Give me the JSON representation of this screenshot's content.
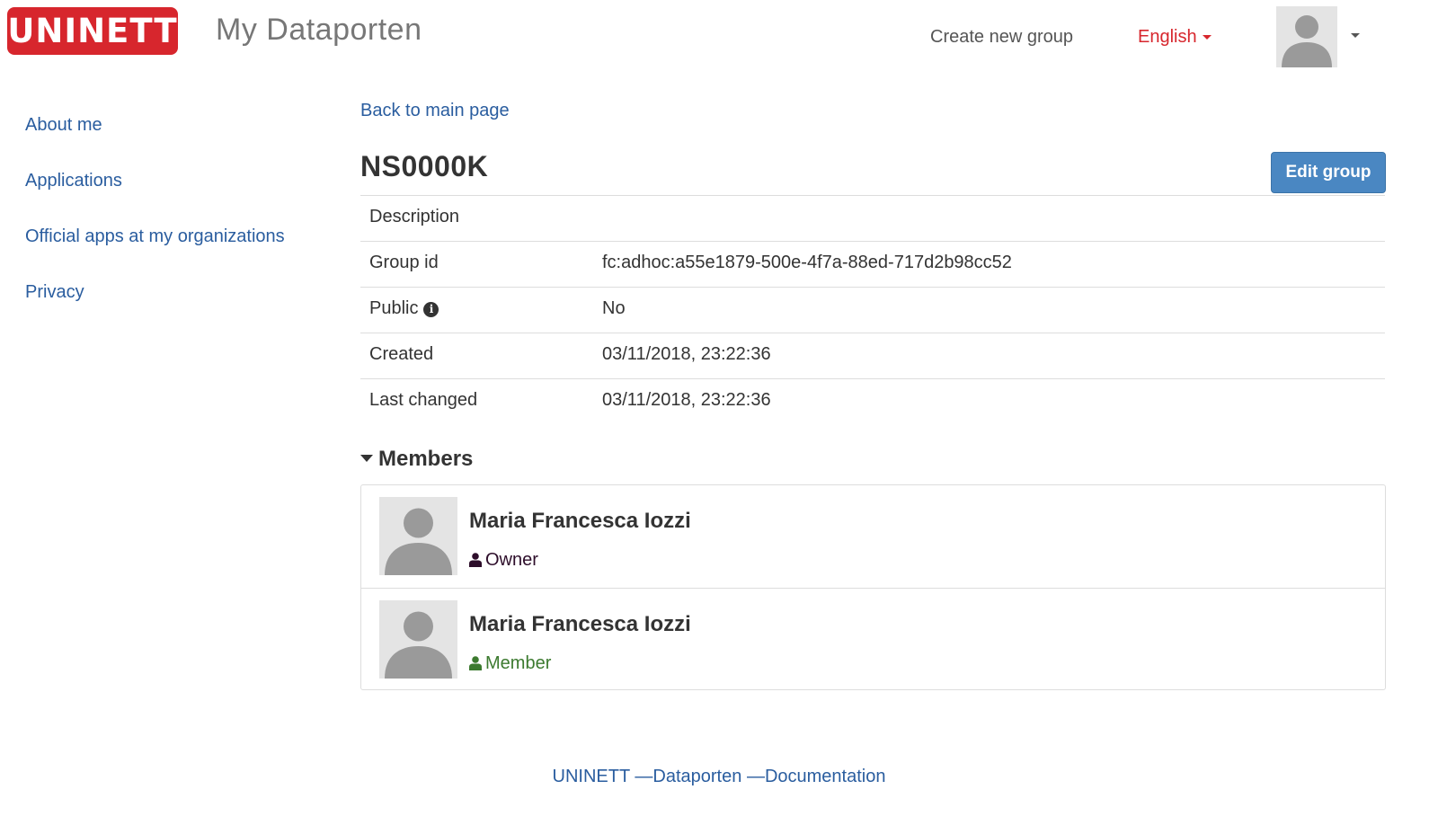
{
  "header": {
    "logo_text": "UNINETT",
    "app_title": "My Dataporten",
    "create_group": "Create new group",
    "language": "English"
  },
  "sidebar": {
    "items": [
      {
        "label": "About me"
      },
      {
        "label": "Applications"
      },
      {
        "label": "Official apps at my organizations"
      },
      {
        "label": "Privacy"
      }
    ]
  },
  "main": {
    "back_link": "Back to main page",
    "group_title": "NS0000K",
    "edit_button": "Edit group",
    "info": [
      {
        "label": "Description",
        "value": ""
      },
      {
        "label": "Group id",
        "value": "fc:adhoc:a55e1879-500e-4f7a-88ed-717d2b98cc52"
      },
      {
        "label": "Public",
        "value": "No",
        "icon": "info-icon"
      },
      {
        "label": "Created",
        "value": "03/11/2018, 23:22:36"
      },
      {
        "label": "Last changed",
        "value": "03/11/2018, 23:22:36"
      }
    ],
    "members_heading": "Members",
    "members": [
      {
        "name": "Maria Francesca Iozzi",
        "role": "Owner",
        "role_color": "#2d0d2a"
      },
      {
        "name": "Maria Francesca Iozzi",
        "role": "Member",
        "role_color": "#3c7a2f"
      }
    ]
  },
  "footer": {
    "org": "UNINETT",
    "separator": "—",
    "dataporten": "Dataporten",
    "documentation": "Documentation"
  },
  "colors": {
    "brand_red": "#d7262d",
    "link_blue": "#2a5d9f",
    "button_blue": "#4a87c2"
  }
}
